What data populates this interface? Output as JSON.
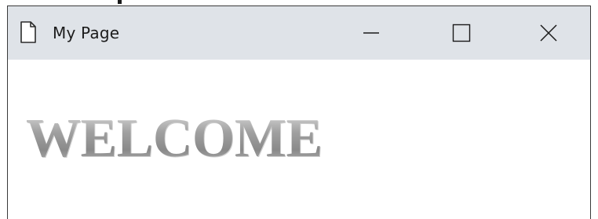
{
  "window": {
    "title": "My Page",
    "icon": "page-icon",
    "controls": {
      "minimize_icon": "minimize-icon",
      "maximize_icon": "maximize-icon",
      "close_icon": "close-icon"
    }
  },
  "content": {
    "heading": "WELCOME"
  },
  "colors": {
    "titlebar": "#dfe3e8",
    "background": "#ffffff",
    "heading_gray": "#9a9a9a"
  }
}
